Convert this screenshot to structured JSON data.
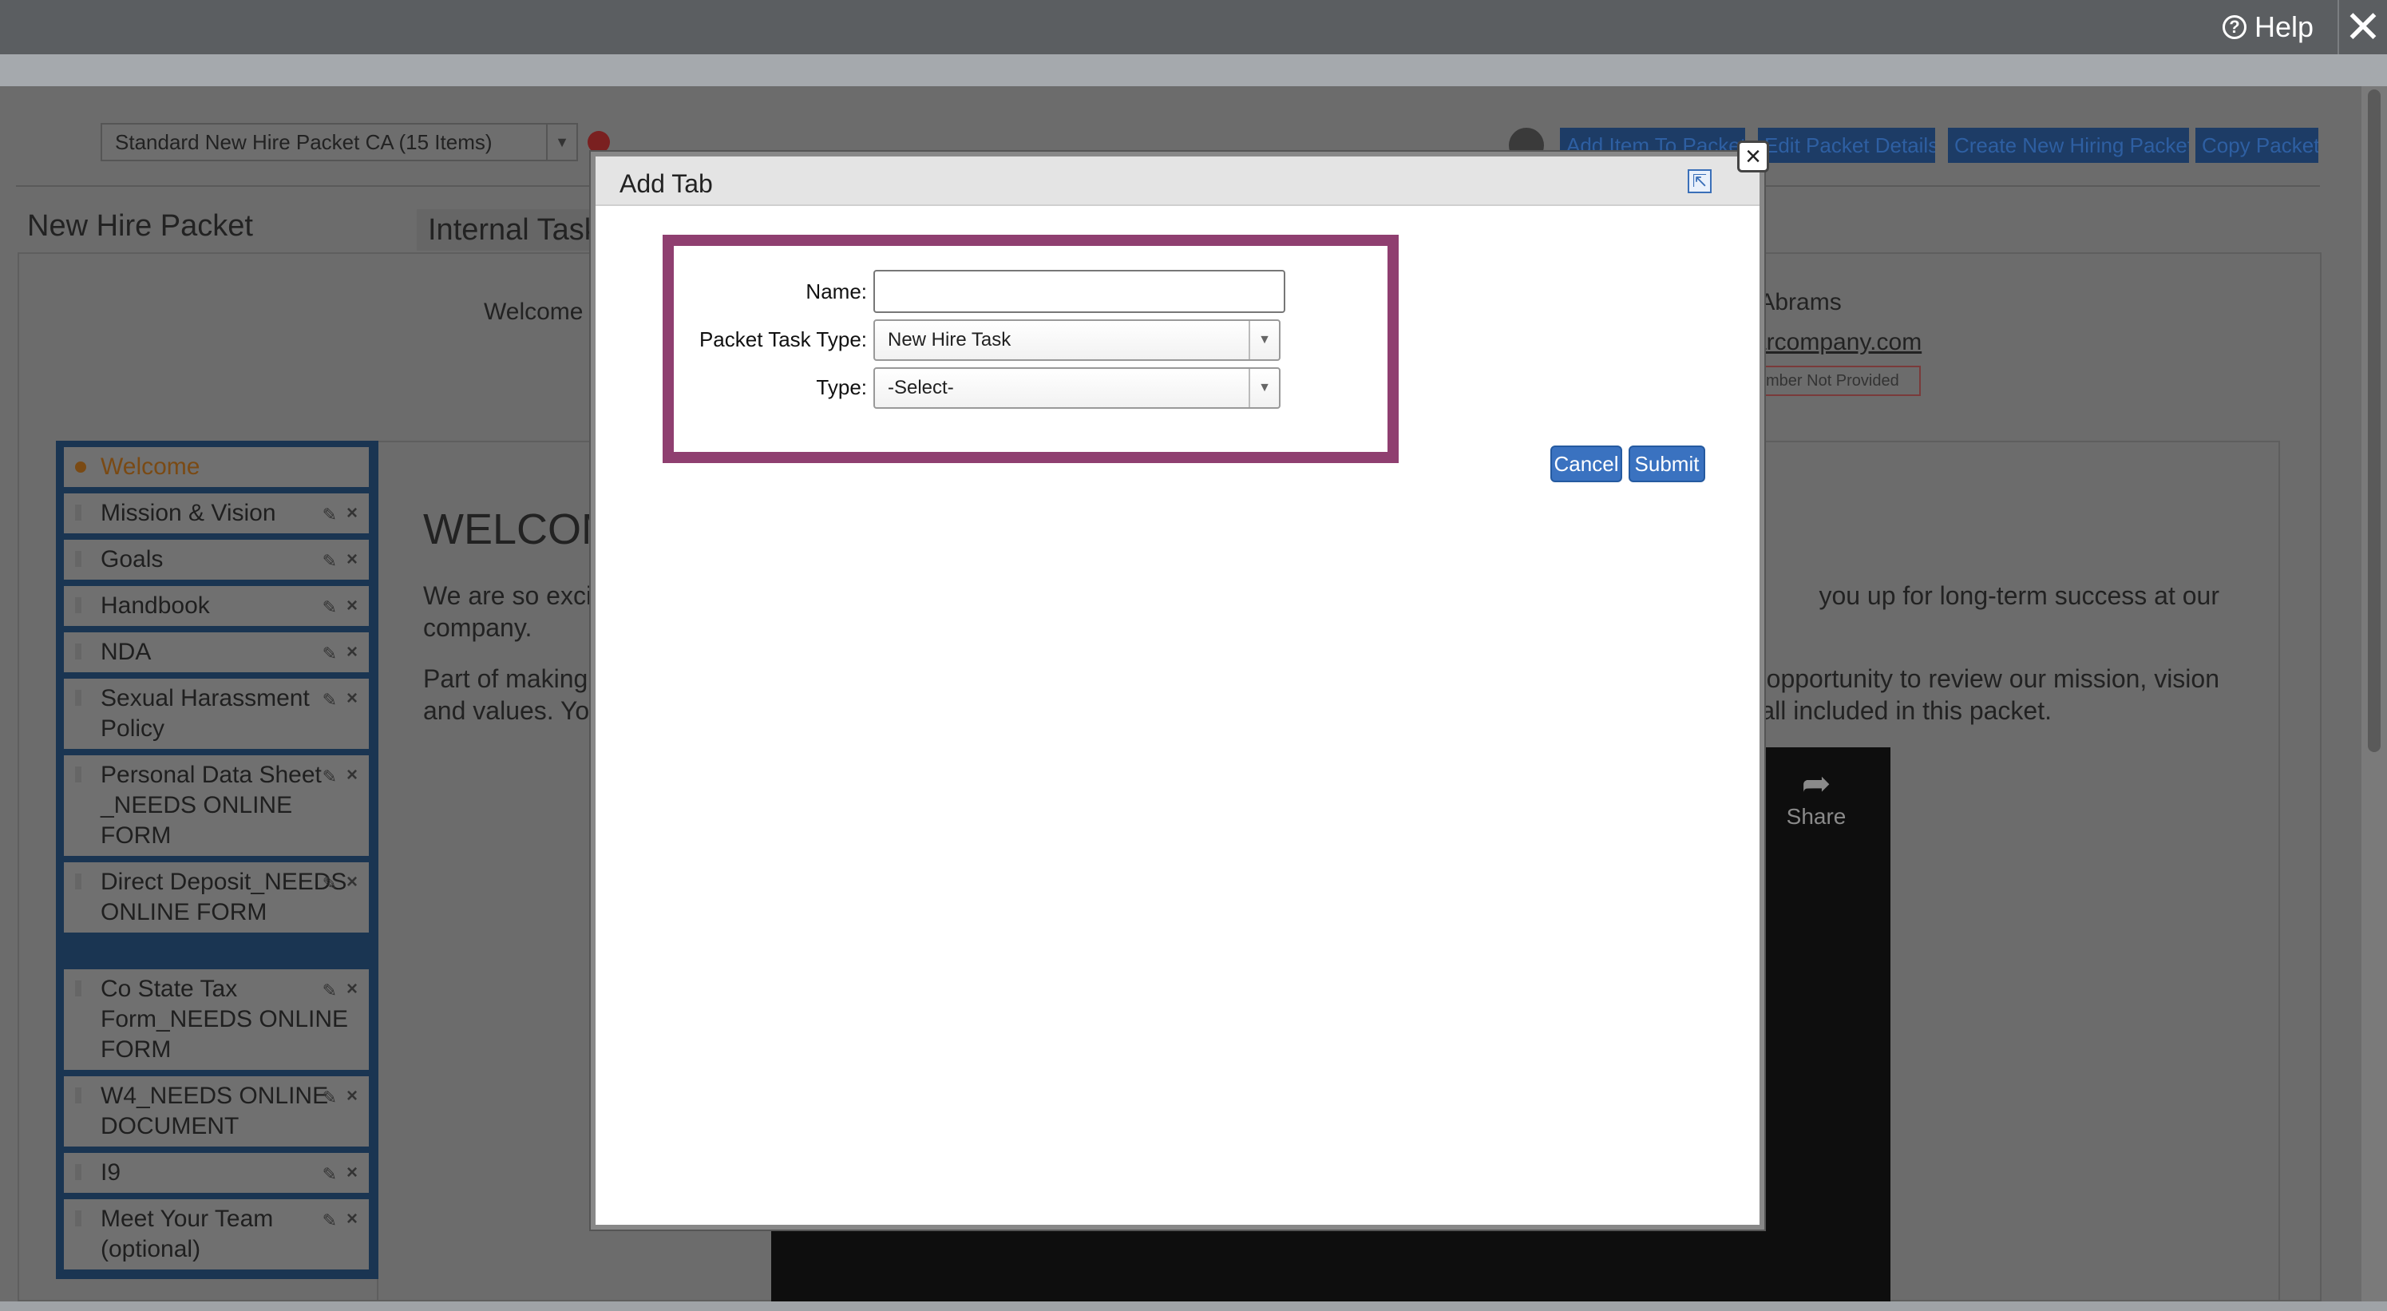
{
  "topbar": {
    "help_label": "Help",
    "close_glyph": "✕"
  },
  "page": {
    "packet_select_value": "Standard New Hire Packet CA (15 Items)",
    "toolbar": {
      "add_item": "Add Item To Packet",
      "edit_details": "Edit Packet Details",
      "create_new": "Create New Hiring Packet",
      "copy": "Copy Packet"
    },
    "title": "New Hire Packet",
    "internal_tab": "Internal Task",
    "welcome_label": "Welcome",
    "employee": {
      "name": "h Abrams",
      "email": "arcompany.com",
      "phone_badge": "mber Not Provided"
    },
    "sidebar": {
      "items": [
        {
          "label": "Welcome"
        },
        {
          "label": "Mission & Vision"
        },
        {
          "label": "Goals"
        },
        {
          "label": "Handbook"
        },
        {
          "label": "NDA"
        },
        {
          "label": "Sexual Harassment Policy"
        },
        {
          "label": "Personal Data Sheet _NEEDS ONLINE FORM"
        },
        {
          "label": "Direct Deposit_NEEDS ONLINE FORM"
        },
        {
          "label": "Co State Tax Form_NEEDS ONLINE FORM"
        },
        {
          "label": "W4_NEEDS ONLINE DOCUMENT"
        },
        {
          "label": "I9"
        },
        {
          "label": "Meet Your Team (optional)"
        }
      ]
    },
    "content": {
      "heading": "WELCOM",
      "para1_left": "We are so excit",
      "para1_right": "you up for long-term success at our",
      "para1_line2": "company.",
      "para2_left": "Part of making",
      "para2_right": "opportunity to review our mission, vision",
      "para2_line2_left": "and values. You",
      "para2_line2_right": "all included in this packet.",
      "share_label": "Share"
    }
  },
  "modal": {
    "title": "Add Tab",
    "fields": {
      "name_label": "Name:",
      "name_value": "",
      "packet_task_type_label": "Packet Task Type:",
      "packet_task_type_value": "New Hire Task",
      "type_label": "Type:",
      "type_value": "-Select-"
    },
    "buttons": {
      "cancel": "Cancel",
      "submit": "Submit"
    },
    "close_glyph": "×"
  },
  "colors": {
    "highlight": "#8f3f70",
    "button_blue": "#3a72c0"
  }
}
